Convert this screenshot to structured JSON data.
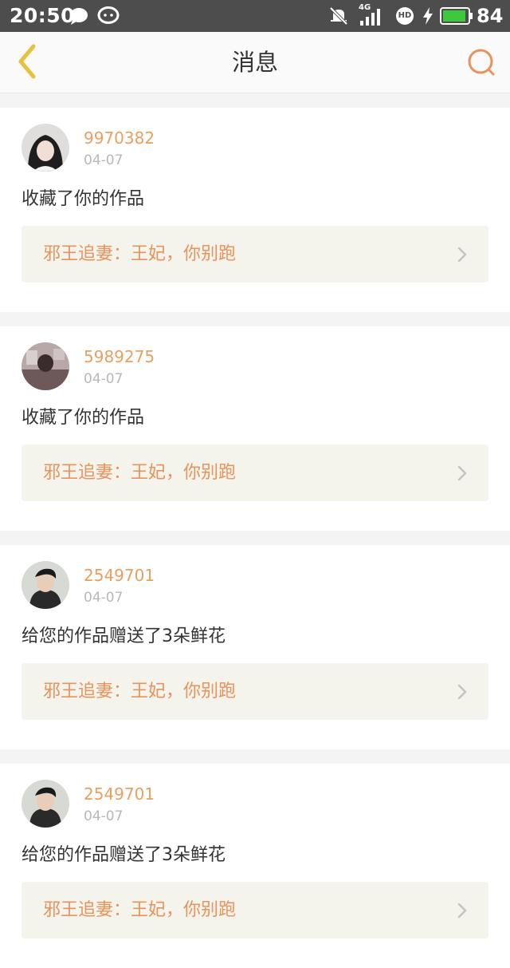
{
  "status_bar": {
    "time": "20:50",
    "network": "4G",
    "hd_badge": "HD",
    "battery": "84",
    "icons": [
      "chat-bubble-icon",
      "wechat-icon",
      "muted-bell-icon",
      "signal-icon",
      "hd-icon",
      "charging-icon",
      "battery-icon"
    ]
  },
  "header": {
    "title": "消息",
    "back_icon": "chevron-left-icon",
    "search_icon": "search-icon"
  },
  "colors": {
    "accent": "#e8935c",
    "back_icon": "#e8c040",
    "card_link_bg": "#f4f4ec"
  },
  "messages": [
    {
      "username": "9970382",
      "date": "04-07",
      "text": "收藏了你的作品",
      "work_title": "邪王追妻：王妃，你别跑"
    },
    {
      "username": "5989275",
      "date": "04-07",
      "text": "收藏了你的作品",
      "work_title": "邪王追妻：王妃，你别跑"
    },
    {
      "username": "2549701",
      "date": "04-07",
      "text": "给您的作品赠送了3朵鲜花",
      "work_title": "邪王追妻：王妃，你别跑"
    },
    {
      "username": "2549701",
      "date": "04-07",
      "text": "给您的作品赠送了3朵鲜花",
      "work_title": "邪王追妻：王妃，你别跑"
    }
  ]
}
